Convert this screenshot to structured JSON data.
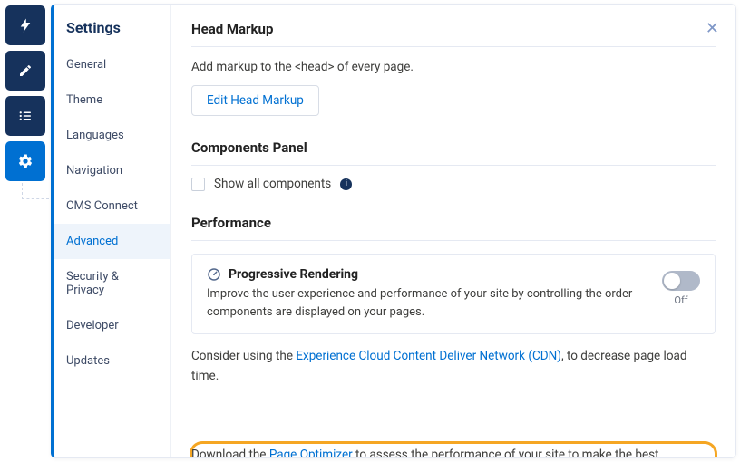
{
  "sidebar": {
    "title": "Settings",
    "items": [
      {
        "label": "General"
      },
      {
        "label": "Theme"
      },
      {
        "label": "Languages"
      },
      {
        "label": "Navigation"
      },
      {
        "label": "CMS Connect"
      },
      {
        "label": "Advanced"
      },
      {
        "label": "Security & Privacy"
      },
      {
        "label": "Developer"
      },
      {
        "label": "Updates"
      }
    ],
    "activeIndex": 5
  },
  "headMarkup": {
    "title": "Head Markup",
    "description": "Add markup to the <head> of every page.",
    "button": "Edit Head Markup"
  },
  "componentsPanel": {
    "title": "Components Panel",
    "checkboxLabel": "Show all components"
  },
  "performance": {
    "title": "Performance",
    "progressive": {
      "title": "Progressive Rendering",
      "description": "Improve the user experience and performance of your site by controlling the order components are displayed on your pages.",
      "toggleState": "Off"
    },
    "cdn": {
      "pre": "Consider using the ",
      "link": "Experience Cloud Content Deliver Network (CDN)",
      "post": ", to decrease page load time."
    },
    "optimizer": {
      "pre": "Download the ",
      "link": "Page Optimizer",
      "post": " to assess the performance of your site to make the best"
    }
  },
  "icons": {
    "lightning": "lightning-icon",
    "pencil": "pencil-icon",
    "list": "list-icon",
    "gear": "gear-icon",
    "info": "i"
  }
}
